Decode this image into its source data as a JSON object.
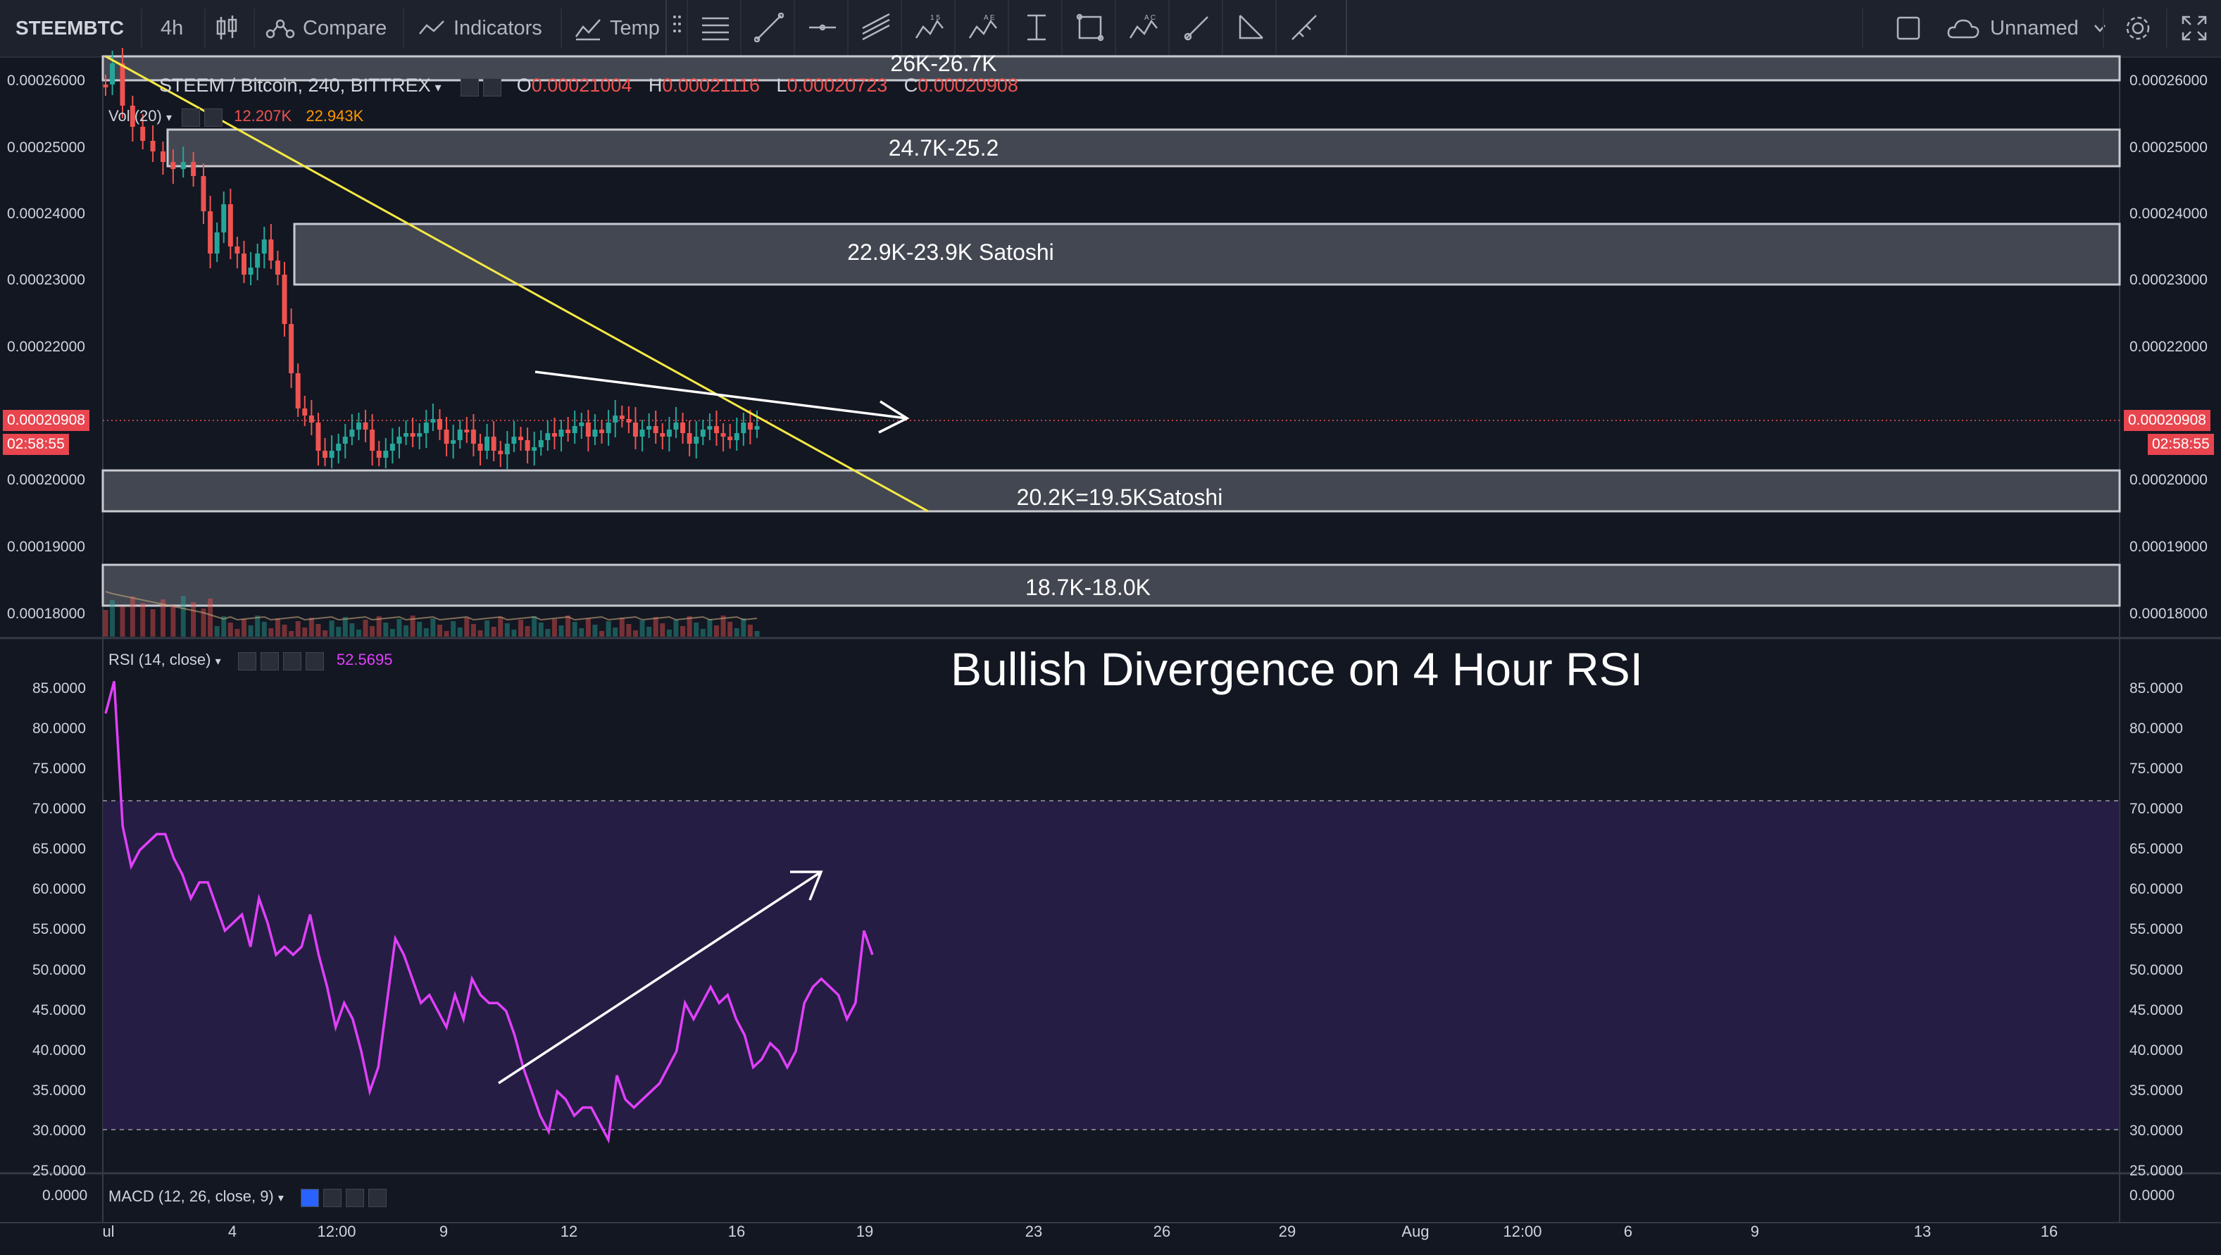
{
  "toolbar": {
    "symbol": "STEEMBTC",
    "interval": "4h",
    "compare_label": "Compare",
    "indicators_label": "Indicators",
    "templates_label": "Temp",
    "layout_name": "Unnamed"
  },
  "legend": {
    "title": "STEEM / Bitcoin, 240, BITTREX",
    "o_label": "O",
    "o_value": "0.00021004",
    "h_label": "H",
    "h_value": "0.00021116",
    "l_label": "L",
    "l_value": "0.00020723",
    "c_label": "C",
    "c_value": "0.00020908",
    "vol_label": "Vol (20)",
    "vol_value_1": "12.207K",
    "vol_value_2": "22.943K"
  },
  "price_axis": {
    "labels": [
      "0.00026000",
      "0.00025000",
      "0.00024000",
      "0.00023000",
      "0.00022000",
      "0.00020000",
      "0.00019000",
      "0.00018000"
    ],
    "current_price": "0.00020908",
    "countdown": "02:58:55"
  },
  "rsi": {
    "legend": "RSI (14, close)",
    "value": "52.5695",
    "labels": [
      "85.0000",
      "80.0000",
      "75.0000",
      "70.0000",
      "65.0000",
      "60.0000",
      "55.0000",
      "50.0000",
      "45.0000",
      "40.0000",
      "35.0000",
      "30.0000",
      "25.0000"
    ]
  },
  "macd": {
    "legend": "MACD (12, 26, close, 9)",
    "value": "0.0000"
  },
  "time_axis": {
    "labels": [
      "ul",
      "4",
      "12:00",
      "9",
      "12",
      "16",
      "19",
      "23",
      "26",
      "29",
      "Aug",
      "12:00",
      "6",
      "9",
      "13",
      "16"
    ]
  },
  "zones": {
    "z1": "26K-26.7K",
    "z2": "24.7K-25.2",
    "z3": "22.9K-23.9K Satoshi",
    "z4": "20.2K=19.5KSatoshi",
    "z5": "18.7K-18.0K"
  },
  "annotation": {
    "title": "Bullish Divergence on 4 Hour RSI"
  },
  "colors": {
    "background": "#131722",
    "up": "#26a69a",
    "down": "#ef5350",
    "rsi_line": "#e040fb",
    "trendline": "#f5e944",
    "zone_fill": "#6b6f7a"
  },
  "chart_data": {
    "type": "line",
    "title": "STEEM / Bitcoin, 240, BITTREX",
    "rsi_series": {
      "name": "RSI (14, close)",
      "y": [
        82,
        86,
        68,
        63,
        65,
        66,
        67,
        67,
        64,
        62,
        59,
        61,
        61,
        58,
        55,
        56,
        57,
        53,
        59,
        56,
        52,
        53,
        52,
        53,
        57,
        52,
        48,
        43,
        46,
        44,
        40,
        35,
        38,
        46,
        54,
        52,
        49,
        46,
        47,
        45,
        43,
        47,
        44,
        49,
        47,
        46,
        46,
        45,
        42,
        38,
        35,
        32,
        30,
        35,
        34,
        32,
        33,
        33,
        31,
        29,
        37,
        34,
        33,
        34,
        35,
        36,
        38,
        40,
        46,
        44,
        46,
        48,
        46,
        47,
        44,
        42,
        38,
        39,
        41,
        40,
        38,
        40,
        46,
        48,
        49,
        48,
        47,
        44,
        46,
        55,
        52
      ],
      "ylim": [
        25,
        87
      ]
    }
  }
}
